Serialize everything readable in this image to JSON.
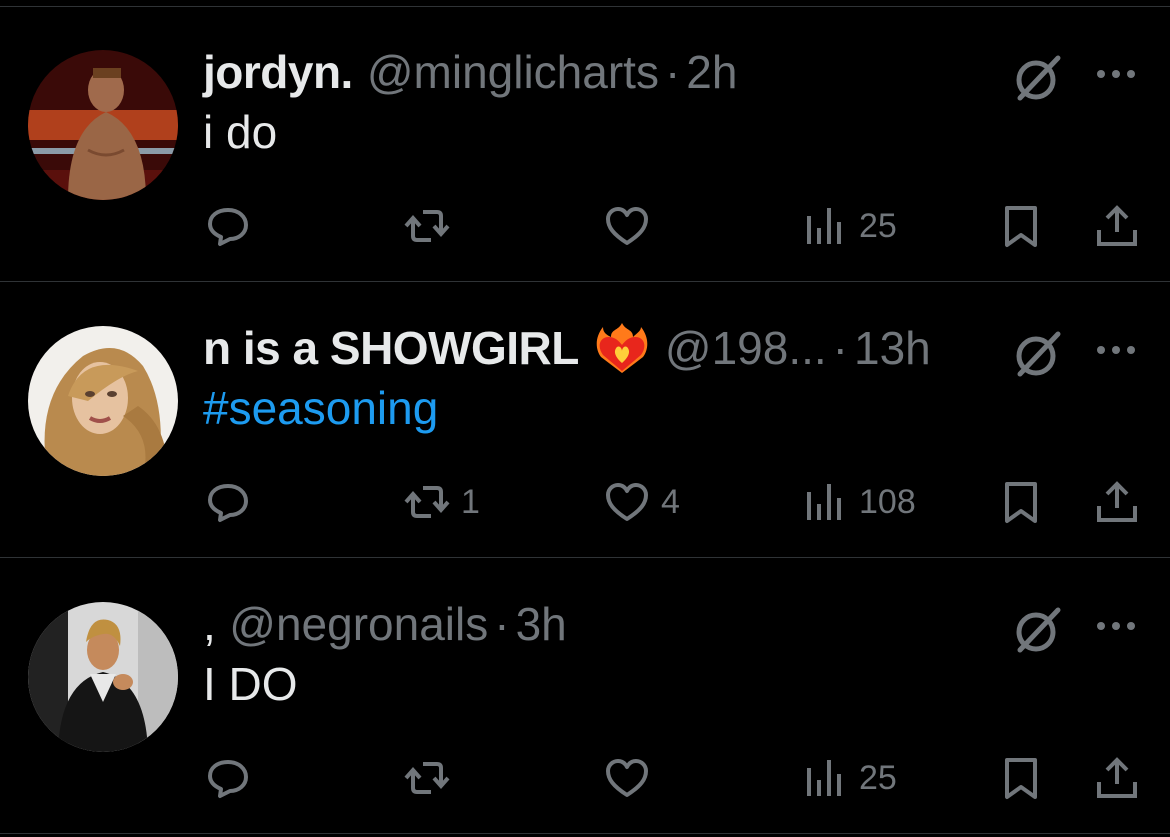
{
  "tweets": [
    {
      "name": "jordyn.",
      "handle": "@minglicharts",
      "separator": "·",
      "time": "2h",
      "text": "i do",
      "text_is_hashtag": false,
      "emoji": "",
      "avatar": "wrestler-avatar",
      "replies": "",
      "retweets": "",
      "likes": "",
      "views": "25"
    },
    {
      "name": "n is a SHOWGIRL",
      "handle": "@198...",
      "separator": "·",
      "time": "13h",
      "text": "#seasoning",
      "text_is_hashtag": true,
      "emoji": "heart-on-fire-emoji",
      "avatar": "blonde-woman-avatar",
      "replies": "",
      "retweets": "1",
      "likes": "4",
      "views": "108"
    },
    {
      "name": ",",
      "handle": "@negronails",
      "separator": "·",
      "time": "3h",
      "text": "I DO",
      "text_is_hashtag": false,
      "emoji": "",
      "avatar": "woman-jacket-avatar",
      "replies": "",
      "retweets": "",
      "likes": "",
      "views": "25"
    }
  ],
  "icons": {
    "reply": "reply-icon",
    "retweet": "retweet-icon",
    "like": "heart-icon",
    "views": "views-icon",
    "bookmark": "bookmark-icon",
    "share": "share-icon",
    "grok": "grok-icon",
    "more": "more-icon"
  },
  "colors": {
    "background": "#000000",
    "text": "#e7e9ea",
    "muted": "#71767b",
    "link": "#1d9bf0",
    "divider": "#2f3336"
  }
}
